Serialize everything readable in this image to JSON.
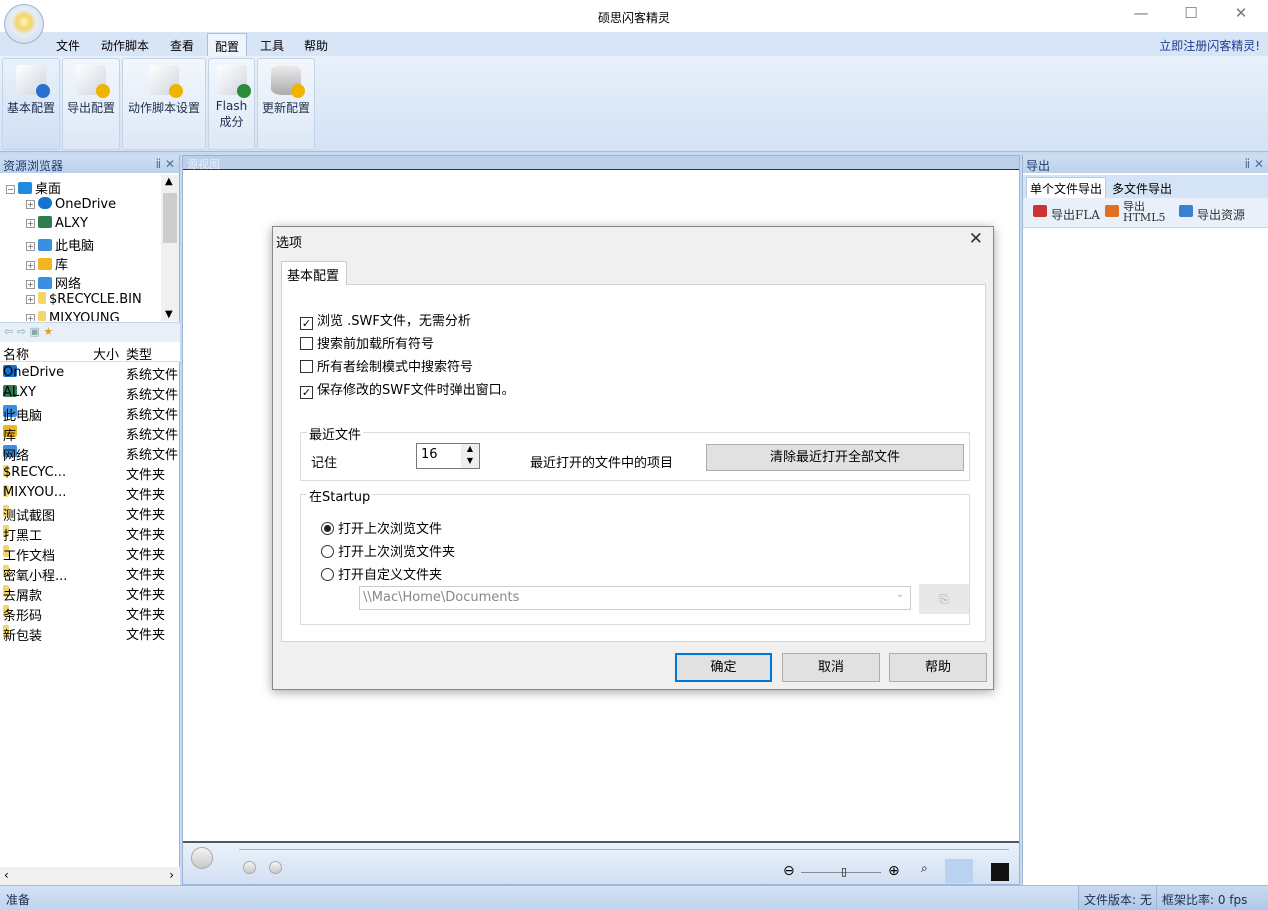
{
  "window": {
    "title": "硕思闪客精灵",
    "controls": [
      "minimize",
      "maximize",
      "close"
    ]
  },
  "menu": {
    "items": [
      "文件",
      "动作脚本",
      "查看",
      "配置",
      "工具",
      "帮助"
    ],
    "active": "配置",
    "register": "立即注册闪客精灵!"
  },
  "ribbon": {
    "buttons": [
      {
        "label": "基本配置",
        "icon": "scroll-check-icon"
      },
      {
        "label": "导出配置",
        "icon": "scroll-gear-icon"
      },
      {
        "label": "动作脚本设置",
        "icon": "scroll-wrench-icon"
      },
      {
        "label": "Flash",
        "label2": "成分",
        "icon": "scroll-components-icon"
      },
      {
        "label": "更新配置",
        "icon": "database-gear-icon"
      }
    ]
  },
  "left": {
    "title": "资源浏览器",
    "tree": [
      {
        "label": "桌面",
        "level": 0,
        "expanded": true
      },
      {
        "label": "OneDrive",
        "level": 1
      },
      {
        "label": "ALXY",
        "level": 1
      },
      {
        "label": "此电脑",
        "level": 1
      },
      {
        "label": "库",
        "level": 1
      },
      {
        "label": "网络",
        "level": 1
      },
      {
        "label": "$RECYCLE.BIN",
        "level": 1
      },
      {
        "label": "MIXYOUNG",
        "level": 1
      }
    ],
    "columns": [
      "名称",
      "大小",
      "类型"
    ],
    "rows": [
      [
        "OneDrive",
        "系统文件"
      ],
      [
        "ALXY",
        "系统文件"
      ],
      [
        "此电脑",
        "系统文件"
      ],
      [
        "库",
        "系统文件"
      ],
      [
        "网络",
        "系统文件"
      ],
      [
        "$RECYC...",
        "文件夹"
      ],
      [
        "MIXYOU...",
        "文件夹"
      ],
      [
        "测试截图",
        "文件夹"
      ],
      [
        "打黑工",
        "文件夹"
      ],
      [
        "工作文档",
        "文件夹"
      ],
      [
        "密氧小程...",
        "文件夹"
      ],
      [
        "去屑款",
        "文件夹"
      ],
      [
        "条形码",
        "文件夹"
      ],
      [
        "新包装",
        "文件夹"
      ]
    ]
  },
  "center": {
    "title": "源视图"
  },
  "right": {
    "title": "导出",
    "tabs": [
      "单个文件导出",
      "多文件导出"
    ],
    "tools": [
      "导出FLA",
      "导出HTML5",
      "导出资源"
    ]
  },
  "status": {
    "left": "准备",
    "version": "文件版本: 无",
    "fps": "框架比率: 0 fps"
  },
  "dialog": {
    "title": "选项",
    "tab": "基本配置",
    "checks": [
      {
        "label": "浏览 .SWF文件，无需分析",
        "checked": true
      },
      {
        "label": "搜索前加载所有符号",
        "checked": false
      },
      {
        "label": "所有者绘制模式中搜索符号",
        "checked": false
      },
      {
        "label": "保存修改的SWF文件时弹出窗口。",
        "checked": true
      }
    ],
    "recent": {
      "group": "最近文件",
      "remember": "记住",
      "count": "16",
      "items_label": "最近打开的文件中的项目",
      "clear_button": "清除最近打开全部文件"
    },
    "startup": {
      "group": "在Startup",
      "options": [
        {
          "label": "打开上次浏览文件",
          "selected": true
        },
        {
          "label": "打开上次浏览文件夹",
          "selected": false
        },
        {
          "label": "打开自定义文件夹",
          "selected": false
        }
      ],
      "path": "\\\\Mac\\Home\\Documents"
    },
    "buttons": {
      "ok": "确定",
      "cancel": "取消",
      "help": "帮助"
    }
  }
}
